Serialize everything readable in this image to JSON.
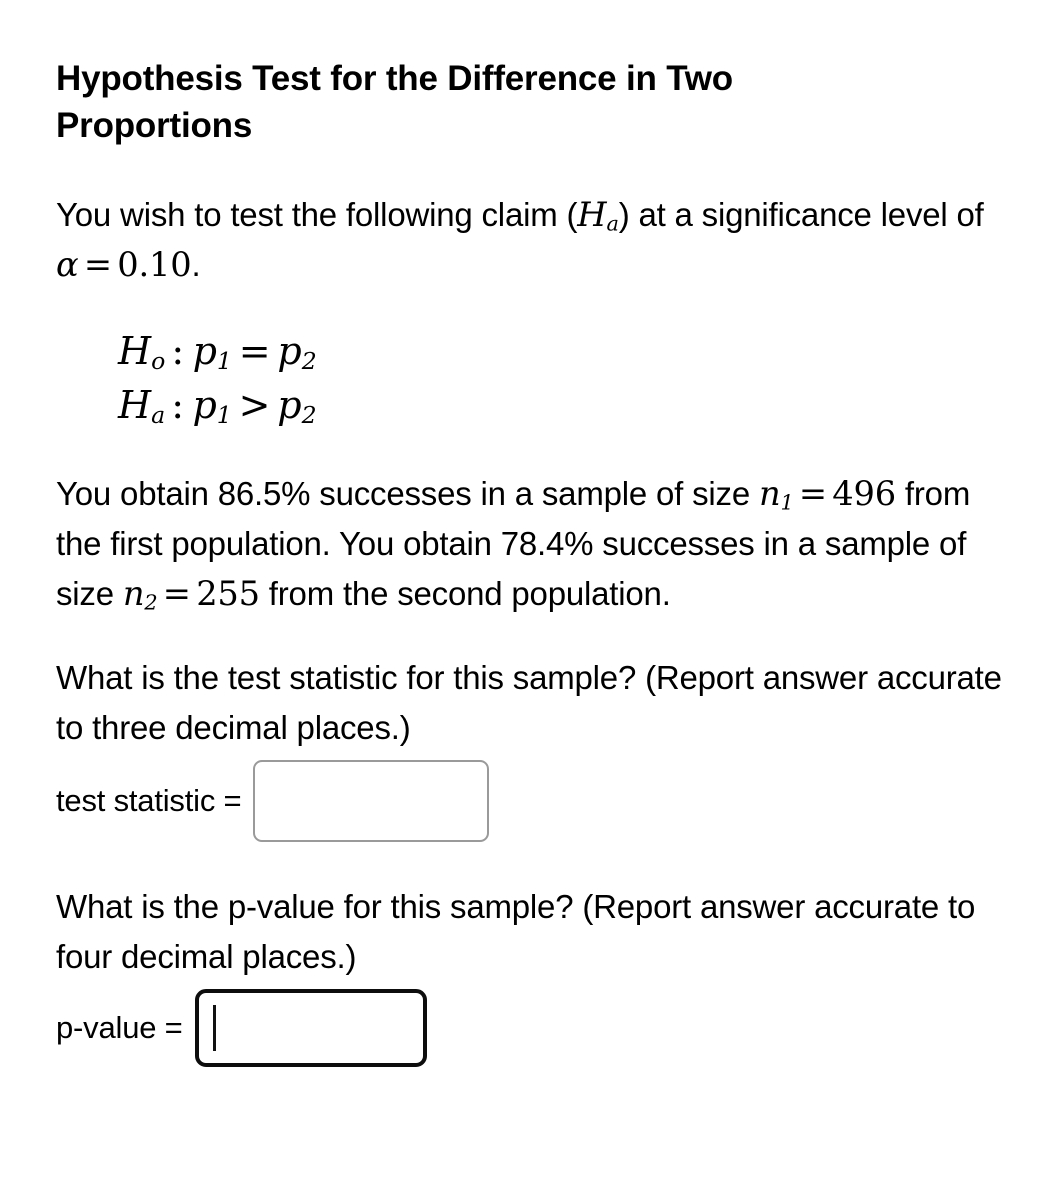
{
  "title": "Hypothesis Test for the Difference in Two Proportions",
  "intro": {
    "part1": "You wish to test the following claim (",
    "math_ha": "H",
    "math_ha_sub": "a",
    "part2": ") at a significance level of ",
    "math_alpha": "α",
    "math_equals": "=",
    "math_alpha_value": "0.10",
    "part3": "."
  },
  "hypotheses": [
    {
      "symbol": "H",
      "subscript": "o",
      "colon": ":",
      "left": "p",
      "left_sub": "1",
      "relation": "=",
      "right": "p",
      "right_sub": "2"
    },
    {
      "symbol": "H",
      "subscript": "a",
      "colon": ":",
      "left": "p",
      "left_sub": "1",
      "relation": ">",
      "right": "p",
      "right_sub": "2"
    }
  ],
  "sample": {
    "part1": "You obtain 86.5% successes in a sample of size ",
    "n1_symbol": "n",
    "n1_sub": "1",
    "n1_equals": "=",
    "n1_value": "496",
    "part2": " from the first population. You obtain 78.4% successes in a sample of size ",
    "n2_symbol": "n",
    "n2_sub": "2",
    "n2_equals": "=",
    "n2_value": "255",
    "part3": " from the second population."
  },
  "test_statistic": {
    "question": "What is the test statistic for this sample? (Report answer accurate to three decimal places.)",
    "label": "test statistic =",
    "value": "",
    "placeholder": ""
  },
  "p_value": {
    "question": "What is the p-value for this sample? (Report answer accurate to four decimal places.)",
    "label": "p-value =",
    "value": "",
    "placeholder": "",
    "focused": true
  },
  "colors": {
    "background": "#ffffff",
    "text": "#000000",
    "field_border": "#9a9a9a",
    "field_border_focused": "#0d0d0d"
  }
}
